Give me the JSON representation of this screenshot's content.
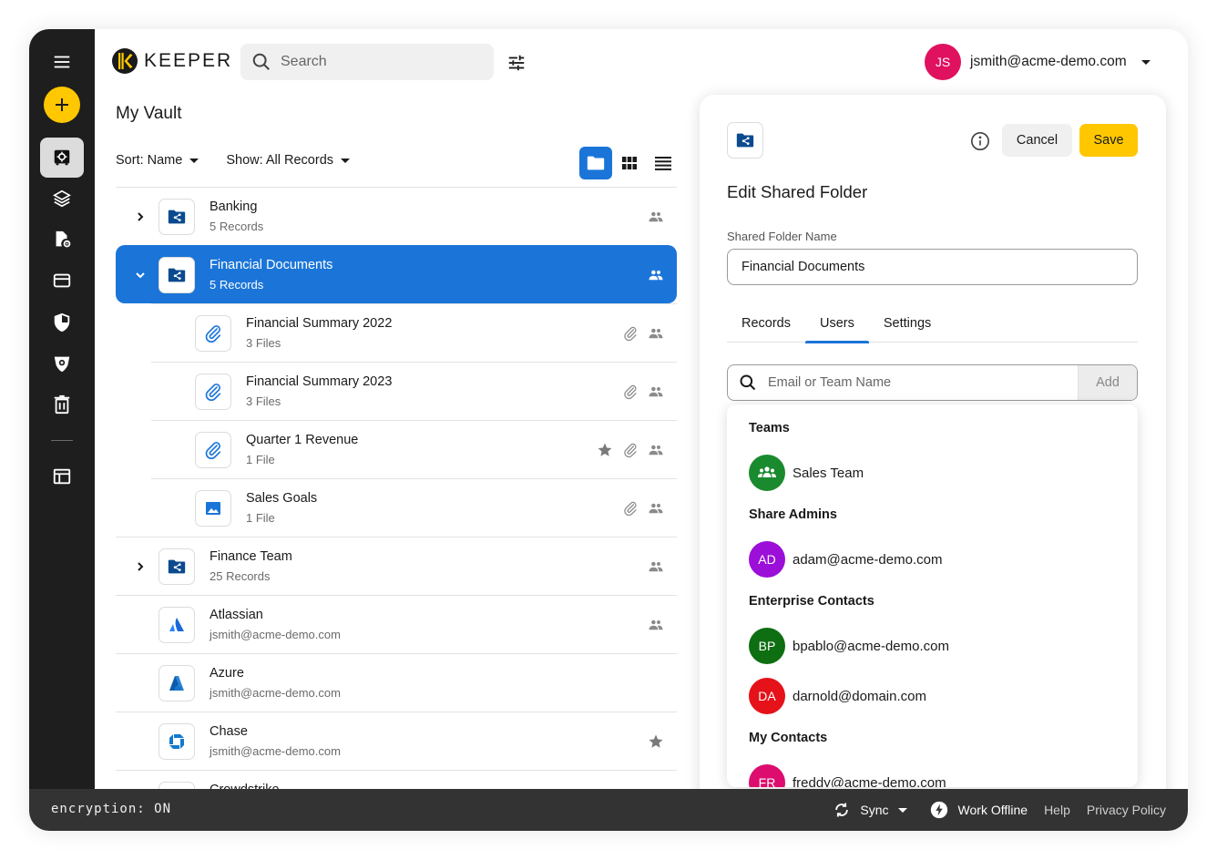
{
  "header": {
    "logo_text": "KEEPER",
    "search_placeholder": "Search",
    "user_initials": "JS",
    "user_email": "jsmith@acme-demo.com"
  },
  "sidebar": {
    "items": [
      {
        "name": "vault",
        "icon": "vault-icon",
        "active": true
      },
      {
        "name": "breachwatch",
        "icon": "layers-icon"
      },
      {
        "name": "file-settings",
        "icon": "file-gear-icon"
      },
      {
        "name": "payment-cards",
        "icon": "credit-card-icon"
      },
      {
        "name": "security-audit",
        "icon": "shield-icon"
      },
      {
        "name": "breach-watch",
        "icon": "eye-shield-icon"
      },
      {
        "name": "trash",
        "icon": "trash-icon"
      },
      {
        "name": "layout",
        "icon": "layout-icon"
      }
    ]
  },
  "vault": {
    "title": "My Vault",
    "sort_label": "Sort: Name",
    "show_label": "Show: All Records",
    "records": [
      {
        "title": "Banking",
        "subtitle": "5 Records",
        "type": "shared-folder",
        "expandable": true,
        "expanded": false,
        "shared": true
      },
      {
        "title": "Financial Documents",
        "subtitle": "5 Records",
        "type": "shared-folder",
        "expandable": true,
        "expanded": true,
        "selected": true,
        "shared": true
      },
      {
        "title": "Financial Summary 2022",
        "subtitle": "3 Files",
        "type": "attachment",
        "child": true,
        "attachment": true,
        "shared": true
      },
      {
        "title": "Financial Summary 2023",
        "subtitle": "3 Files",
        "type": "attachment",
        "child": true,
        "attachment": true,
        "shared": true
      },
      {
        "title": "Quarter 1 Revenue",
        "subtitle": "1 File",
        "type": "attachment",
        "child": true,
        "favorite": true,
        "attachment": true,
        "shared": true
      },
      {
        "title": "Sales Goals",
        "subtitle": "1 File",
        "type": "image",
        "child": true,
        "attachment": true,
        "shared": true
      },
      {
        "title": "Finance Team",
        "subtitle": "25 Records",
        "type": "shared-folder",
        "expandable": true,
        "expanded": false,
        "shared": true
      },
      {
        "title": "Atlassian",
        "subtitle": "jsmith@acme-demo.com",
        "type": "atlassian",
        "shared": true
      },
      {
        "title": "Azure",
        "subtitle": "jsmith@acme-demo.com",
        "type": "azure"
      },
      {
        "title": "Chase",
        "subtitle": "jsmith@acme-demo.com",
        "type": "chase",
        "favorite": true
      },
      {
        "title": "Crowdstrike",
        "subtitle": "",
        "type": "generic"
      }
    ]
  },
  "panel": {
    "title": "Edit Shared Folder",
    "cancel_label": "Cancel",
    "save_label": "Save",
    "name_label": "Shared Folder Name",
    "name_value": "Financial Documents",
    "tabs": [
      {
        "label": "Records",
        "active": false
      },
      {
        "label": "Users",
        "active": true
      },
      {
        "label": "Settings",
        "active": false
      }
    ],
    "user_search_placeholder": "Email or Team Name",
    "add_label": "Add",
    "groups": [
      {
        "heading": "Teams",
        "items": [
          {
            "label": "Sales Team",
            "initials": "",
            "color": "#1a8a2e",
            "team": true
          }
        ]
      },
      {
        "heading": "Share Admins",
        "items": [
          {
            "label": "adam@acme-demo.com",
            "initials": "AD",
            "color": "#9b0fd8"
          }
        ]
      },
      {
        "heading": "Enterprise Contacts",
        "items": [
          {
            "label": "bpablo@acme-demo.com",
            "initials": "BP",
            "color": "#0e6e12"
          },
          {
            "label": "darnold@domain.com",
            "initials": "DA",
            "color": "#e5121a"
          }
        ]
      },
      {
        "heading": "My Contacts",
        "items": [
          {
            "label": "freddy@acme-demo.com",
            "initials": "FR",
            "color": "#dc0d6e"
          }
        ]
      }
    ]
  },
  "footer": {
    "encryption_label": "encryption: ON",
    "sync_label": "Sync",
    "offline_label": "Work Offline",
    "help_label": "Help",
    "privacy_label": "Privacy Policy"
  },
  "colors": {
    "accent": "#1b75d8",
    "brand_yellow": "#ffc700",
    "sidebar_bg": "#1e1e1e",
    "footer_bg": "#333333",
    "folder_blue": "#0b4a8f"
  }
}
